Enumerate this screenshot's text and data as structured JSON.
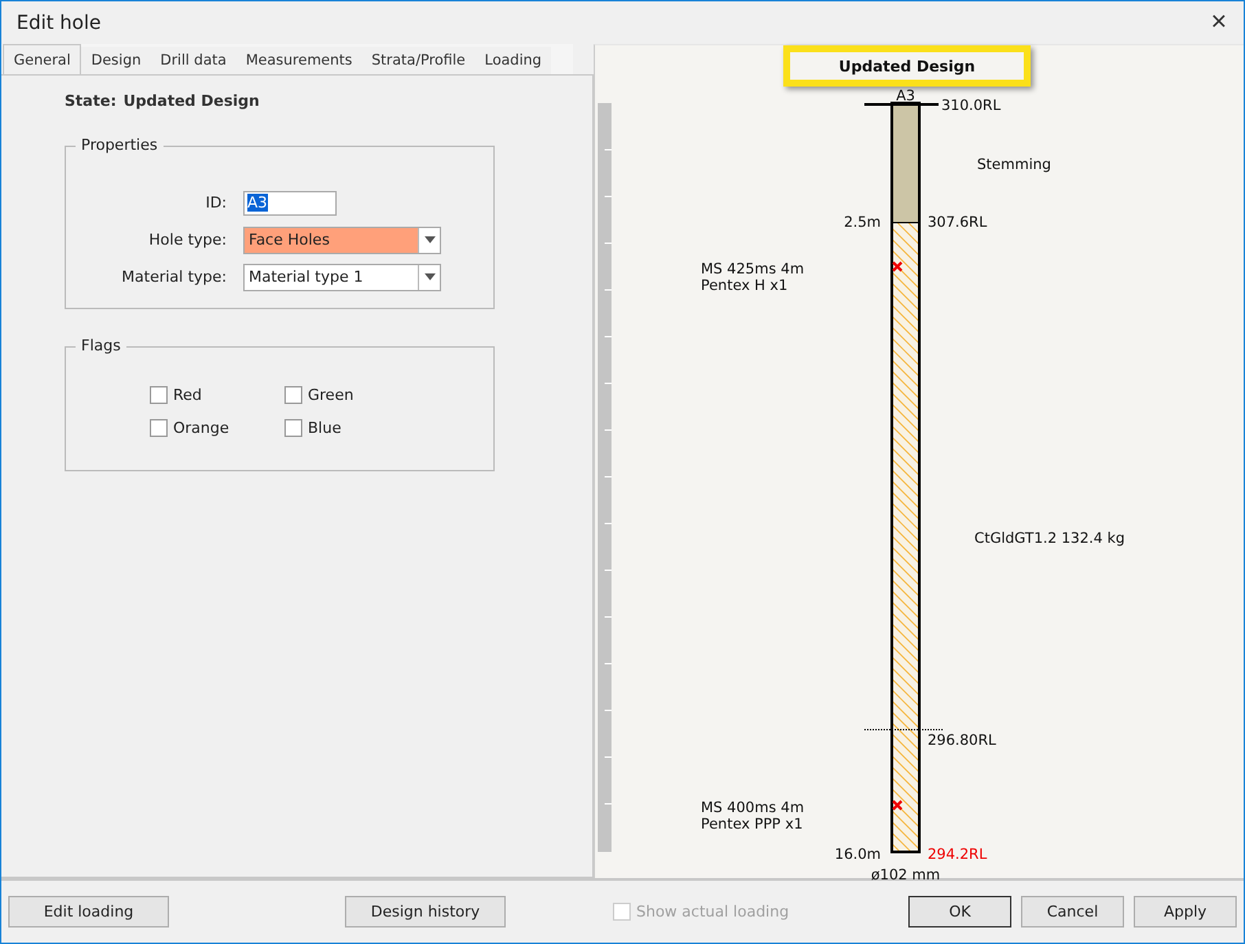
{
  "window": {
    "title": "Edit hole",
    "close": "×"
  },
  "tabs": [
    {
      "label": "General",
      "selected": true
    },
    {
      "label": "Design",
      "selected": false
    },
    {
      "label": "Drill data",
      "selected": false
    },
    {
      "label": "Measurements",
      "selected": false
    },
    {
      "label": "Strata/Profile",
      "selected": false
    },
    {
      "label": "Loading",
      "selected": false
    }
  ],
  "state": {
    "label": "State:",
    "value": "Updated Design"
  },
  "properties": {
    "title": "Properties",
    "id": {
      "label": "ID:",
      "value": "A3"
    },
    "hole_type": {
      "label": "Hole type:",
      "value": "Face Holes",
      "highlighted": true
    },
    "material_type": {
      "label": "Material type:",
      "value": "Material type 1",
      "highlighted": false
    }
  },
  "flags": {
    "title": "Flags",
    "items": [
      {
        "label": "Red",
        "checked": false
      },
      {
        "label": "Green",
        "checked": false
      },
      {
        "label": "Orange",
        "checked": false
      },
      {
        "label": "Blue",
        "checked": false
      }
    ]
  },
  "diagram": {
    "state_label": "Updated Design",
    "hole_id": "A3",
    "collar_rl": "310.0RL",
    "stemming": "Stemming",
    "stemming_depth": "2.5m",
    "stemming_rl": "307.6RL",
    "primer_top": [
      "MS 425ms 4m",
      "Pentex H x1"
    ],
    "explosive": "CtGldGT1.2 132.4 kg",
    "marker_rl": "296.80RL",
    "primer_bottom": [
      "MS 400ms 4m",
      "Pentex PPP x1"
    ],
    "depth": "16.0m",
    "toe_rl": "294.2RL",
    "diameter": "ø102 mm"
  },
  "footer": {
    "edit_loading": "Edit loading",
    "design_history": "Design history",
    "show_actual": {
      "label": "Show actual loading",
      "checked": false,
      "disabled": true
    },
    "buttons": [
      {
        "label": "OK",
        "kind": "default"
      },
      {
        "label": "Cancel",
        "kind": "normal"
      },
      {
        "label": "Apply",
        "kind": "normal"
      }
    ]
  }
}
